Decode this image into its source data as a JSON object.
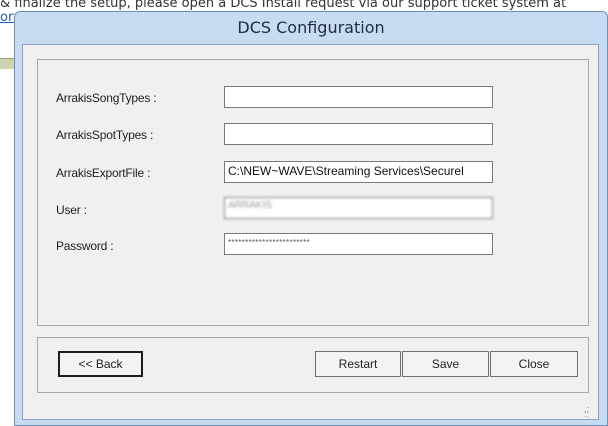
{
  "background": {
    "text_line": "& finalize the setup, please open a DCS Install request via our support ticket system at",
    "link_fragment": "ort"
  },
  "window": {
    "title": "DCS Configuration"
  },
  "form": {
    "song_types": {
      "label": "ArrakisSongTypes :",
      "value": ""
    },
    "spot_types": {
      "label": "ArrakisSpotTypes :",
      "value": ""
    },
    "export_file": {
      "label": "ArrakisExportFile :",
      "value": "C:\\NEW~WAVE\\Streaming Services\\Securel"
    },
    "user": {
      "label": "User :",
      "value": "ARRAKIS"
    },
    "password": {
      "label": "Password :",
      "value": "************************"
    }
  },
  "buttons": {
    "back": "<< Back",
    "restart": "Restart",
    "save": "Save",
    "close": "Close"
  }
}
